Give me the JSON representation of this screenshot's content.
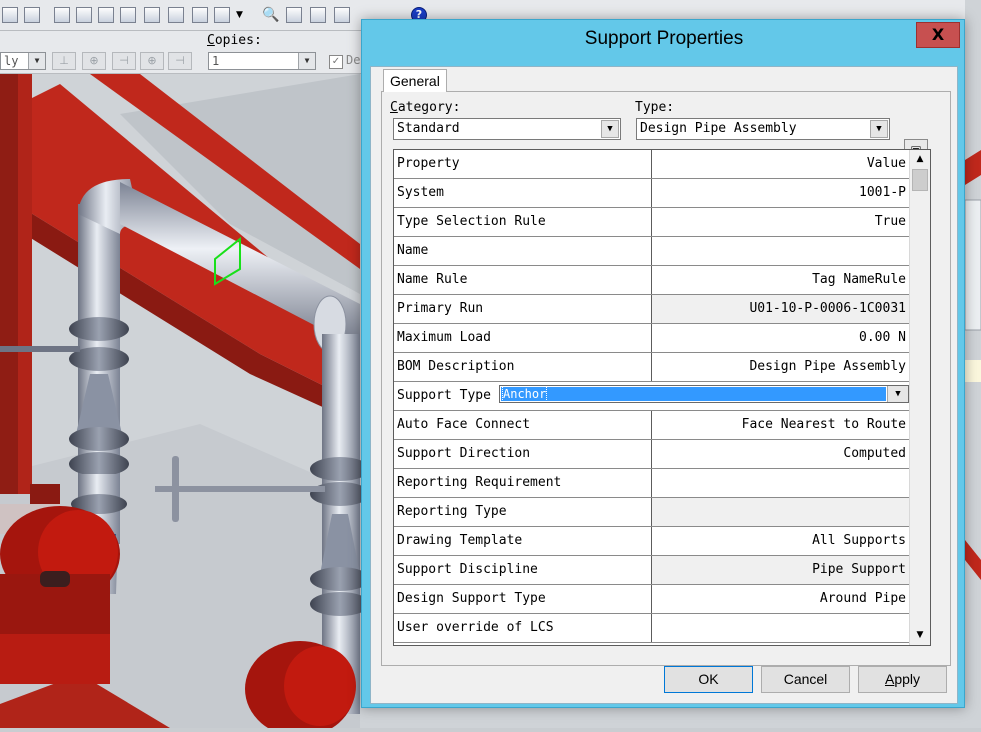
{
  "dialog": {
    "title": "Support Properties",
    "close": "X",
    "tab": "General",
    "category_label_pre": "C",
    "category_label_rest": "ategory:",
    "category_value": "Standard",
    "type_label": "Type:",
    "type_value": "Design Pipe Assembly",
    "grid": {
      "header": {
        "property": "Property",
        "value": "Value"
      },
      "rows": [
        {
          "property": "System",
          "value": "1001-P"
        },
        {
          "property": "Type Selection Rule",
          "value": "True"
        },
        {
          "property": "Name",
          "value": ""
        },
        {
          "property": "Name Rule",
          "value": "Tag NameRule"
        },
        {
          "property": "Primary Run",
          "value": "U01-10-P-0006-1C0031"
        },
        {
          "property": "Maximum Load",
          "value": "0.00 N"
        },
        {
          "property": "BOM Description",
          "value": "Design Pipe Assembly"
        },
        {
          "property": "Support Type",
          "value": "Anchor"
        },
        {
          "property": "Auto Face Connect",
          "value": "Face Nearest to Route"
        },
        {
          "property": "Support Direction",
          "value": "Computed"
        },
        {
          "property": "Reporting Requirement",
          "value": ""
        },
        {
          "property": "Reporting Type",
          "value": ""
        },
        {
          "property": "Drawing Template",
          "value": "All Supports"
        },
        {
          "property": "Support Discipline",
          "value": "Pipe Support"
        },
        {
          "property": "Design Support Type",
          "value": "Around Pipe"
        },
        {
          "property": "User override of LCS",
          "value": ""
        }
      ]
    },
    "buttons": {
      "ok": "OK",
      "cancel": "Cancel",
      "apply_pre": "A",
      "apply_rest": "pply"
    }
  },
  "background_app": {
    "copies_label_pre": "C",
    "copies_label_rest": "opies:",
    "copies_value": "1",
    "left_combo_value": "ly",
    "checkbox_label": "De"
  },
  "colors": {
    "dialog_frame": "#63c8e9",
    "close_button": "#c75050",
    "selection": "#3399ff",
    "steel_red": "#c0281c"
  }
}
